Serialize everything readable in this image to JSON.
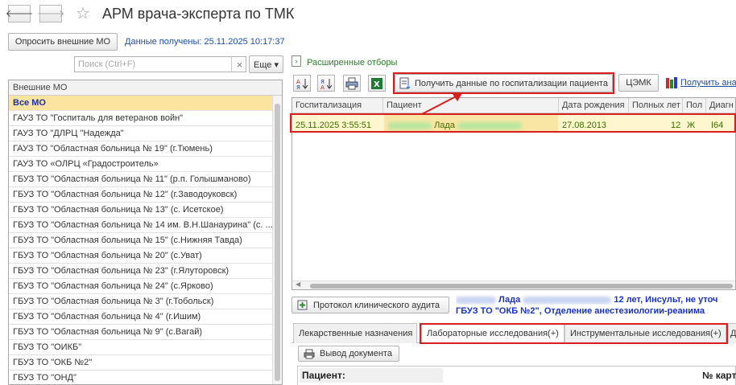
{
  "window": {
    "title": "АРМ врача-эксперта по ТМК",
    "star": "☆"
  },
  "toolbar": {
    "poll_button": "Опросить внешние МО",
    "data_received": "Данные получены: 25.11.2025 10:17:37",
    "search_placeholder": "Поиск (Ctrl+F)",
    "more_button": "Еще ▾",
    "ext_filters": "Расширенные отборы"
  },
  "left_list": {
    "header": "Внешние МО",
    "items": [
      "Все МО",
      "ГАУЗ ТО \"Госпиталь для ветеранов войн\"",
      "ГАУЗ ТО \"ДЛРЦ \"Надежда\"",
      "ГАУЗ ТО \"Областная больница № 19\" (г.Тюмень)",
      "ГАУЗ ТО «ОЛРЦ «Градостроитель»",
      "ГБУЗ ТО \"Областная больница № 11\" (р.п. Голышманово)",
      "ГБУЗ ТО \"Областная больница № 12\" (г.Заводоуковск)",
      "ГБУЗ ТО \"Областная больница № 13\" (с. Исетское)",
      "ГБУЗ ТО \"Областная больница № 14 им. В.Н.Шанаурина\" (с. ...",
      "ГБУЗ ТО \"Областная больница № 15\" (с.Нижняя Тавда)",
      "ГБУЗ ТО \"Областная больница № 20\" (с.Уват)",
      "ГБУЗ ТО \"Областная больница № 23\" (г.Ялуторовск)",
      "ГБУЗ ТО \"Областная больница № 24\" (с.Ярково)",
      "ГБУЗ ТО \"Областная больница № 3\" (г.Тобольск)",
      "ГБУЗ ТО \"Областная больница № 4\" (г.Ишим)",
      "ГБУЗ ТО \"Областная больница № 9\" (с.Вагай)",
      "ГБУЗ ТО \"ОИКБ\"",
      "ГБУЗ ТО \"ОКБ №2\"",
      "ГБУЗ ТО \"ОНД\""
    ]
  },
  "right_toolbar": {
    "get_data_button": "Получить данные по госпитализации пациента",
    "cemk_button": "ЦЭМК",
    "get_ana_link": "Получить ана"
  },
  "grid": {
    "columns": [
      "Госпитализация",
      "Пациент",
      "Дата рождения",
      "Полных лет",
      "Пол",
      "Диагн"
    ],
    "row": {
      "date": "25.11.2025 3:55:51",
      "patient": "Лада",
      "birth": "27.08.2013",
      "age": "12",
      "sex": "Ж",
      "diag": "I64"
    }
  },
  "bottom": {
    "protocol_button": "Протокол клинического аудита",
    "info_name": "Лада",
    "info_line1_rest": "12 лет, Инсульт, не уточ",
    "info_line2": "ГБУЗ ТО \"ОКБ №2\", Отделение анестезиологии-реанима",
    "tabs": [
      "Лекарственные назначения",
      "Лабораторные исследования(+)",
      "Инструментальные исследования(+)",
      "Д"
    ],
    "print_button": "Вывод документа",
    "patient_label": "Пациент:",
    "card_label": "№ карт"
  },
  "colors": {
    "accent_red": "#d81e1e",
    "selection": "#fbe3a0",
    "row_green_text": "#3b6f00",
    "link_blue": "#1c4fa8"
  }
}
